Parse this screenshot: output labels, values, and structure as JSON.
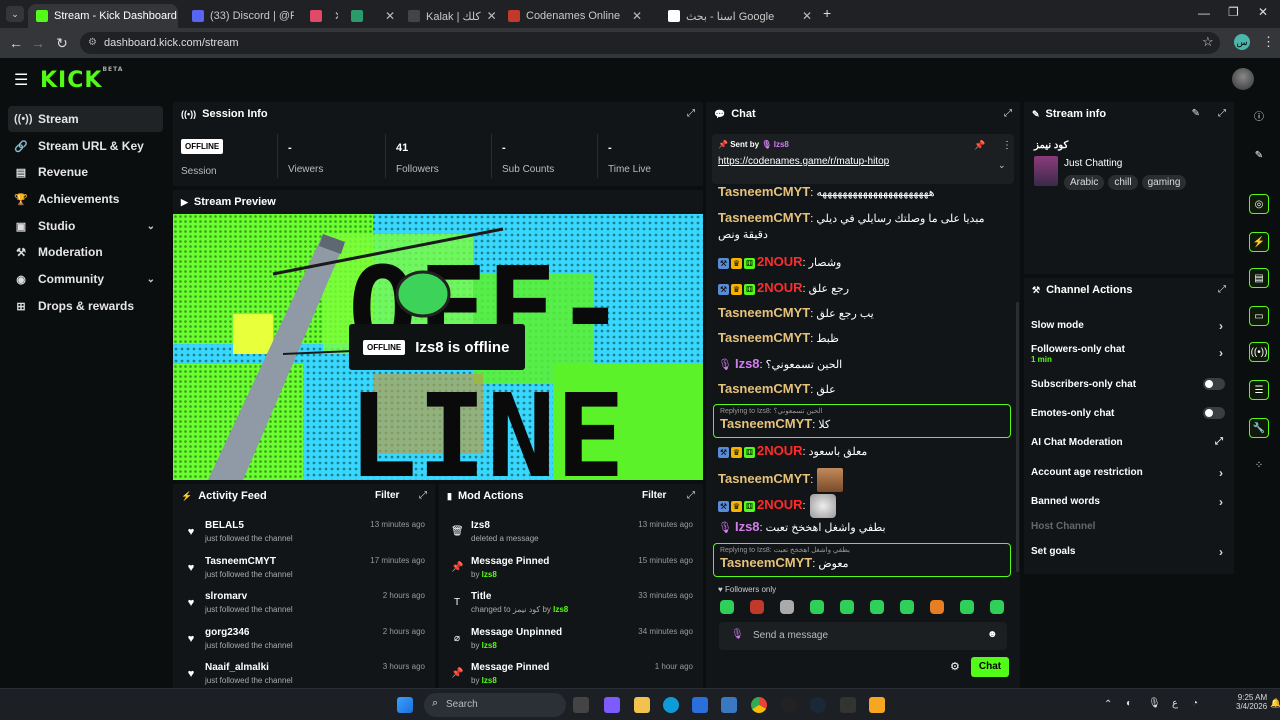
{
  "browser": {
    "tabs": [
      {
        "title": "Stream - Kick Dashboard",
        "color": "#53fc18",
        "active": true
      },
      {
        "title": "(33) Discord | @R.x",
        "color": "#5865f2",
        "active": false
      },
      {
        "title": "",
        "color": "#e04a6a",
        "active": false
      },
      {
        "title": "",
        "color": "#2b9b6b",
        "active": false
      },
      {
        "title": "Kalak | كلك",
        "color": "#444444",
        "active": false
      },
      {
        "title": "Codenames Online",
        "color": "#c0392b",
        "active": false
      },
      {
        "title": "اسنا - بحث Google",
        "color": "#ffffff",
        "active": false
      }
    ],
    "url": "dashboard.kick.com/stream",
    "profile_initial": "س"
  },
  "kick": {
    "logo": "KICK",
    "logo_sup": "BETA"
  },
  "sidebar": {
    "items": [
      {
        "label": "Stream",
        "icon": "stream-icon",
        "glyph": "((•))",
        "chevron": false,
        "active": true
      },
      {
        "label": "Stream URL & Key",
        "icon": "link-icon",
        "glyph": "🔗",
        "chevron": false,
        "active": false
      },
      {
        "label": "Revenue",
        "icon": "chart-icon",
        "glyph": "▤",
        "chevron": false,
        "active": false
      },
      {
        "label": "Achievements",
        "icon": "trophy-icon",
        "glyph": "🏆",
        "chevron": false,
        "active": false
      },
      {
        "label": "Studio",
        "icon": "studio-icon",
        "glyph": "▣",
        "chevron": true,
        "active": false
      },
      {
        "label": "Moderation",
        "icon": "hammer-icon",
        "glyph": "⚒",
        "chevron": false,
        "active": false
      },
      {
        "label": "Community",
        "icon": "globe-icon",
        "glyph": "◉",
        "chevron": true,
        "active": false
      },
      {
        "label": "Drops & rewards",
        "icon": "gift-icon",
        "glyph": "⊞",
        "chevron": false,
        "active": false
      }
    ]
  },
  "session": {
    "title": "Session Info",
    "status_badge": "OFFLINE",
    "status_label": "Session",
    "stats": [
      {
        "value": "-",
        "label": "Viewers"
      },
      {
        "value": "41",
        "label": "Followers"
      },
      {
        "value": "-",
        "label": "Sub Counts"
      },
      {
        "value": "-",
        "label": "Time Live"
      }
    ]
  },
  "preview": {
    "title": "Stream Preview",
    "badge": "OFFLINE",
    "message": "Izs8 is offline",
    "art_line1": "OFF-",
    "art_line2": "LINE"
  },
  "activity": {
    "title": "Activity Feed",
    "filter": "Filter",
    "items": [
      {
        "name": "BELAL5",
        "sub": "just followed the channel",
        "time": "13 minutes ago"
      },
      {
        "name": "TasneemCMYT",
        "sub": "just followed the channel",
        "time": "17 minutes ago"
      },
      {
        "name": "slromarv",
        "sub": "just followed the channel",
        "time": "2 hours ago"
      },
      {
        "name": "gorg2346",
        "sub": "just followed the channel",
        "time": "2 hours ago"
      },
      {
        "name": "Naaif_almalki",
        "sub": "just followed the channel",
        "time": "3 hours ago"
      }
    ]
  },
  "mod_actions": {
    "title": "Mod Actions",
    "filter": "Filter",
    "items": [
      {
        "title": "Izs8",
        "sub_pre": "deleted a message",
        "sub_hi": "",
        "sub_post": "",
        "time": "13 minutes ago",
        "icon": "trash-icon",
        "glyph": "🗑"
      },
      {
        "title": "Message Pinned",
        "sub_pre": "by ",
        "sub_hi": "Izs8",
        "sub_post": "",
        "time": "15 minutes ago",
        "icon": "pin-icon",
        "glyph": "📌"
      },
      {
        "title": "Title",
        "sub_pre": "changed to كود نيمز by ",
        "sub_hi": "Izs8",
        "sub_post": "",
        "time": "33 minutes ago",
        "icon": "title-icon",
        "glyph": "T"
      },
      {
        "title": "Message Unpinned",
        "sub_pre": "by ",
        "sub_hi": "Izs8",
        "sub_post": "",
        "time": "34 minutes ago",
        "icon": "unpin-icon",
        "glyph": "⌀"
      },
      {
        "title": "Message Pinned",
        "sub_pre": "by ",
        "sub_hi": "Izs8",
        "sub_post": "",
        "time": "1 hour ago",
        "icon": "pin-icon",
        "glyph": "📌"
      }
    ]
  },
  "chat": {
    "title": "Chat",
    "pinned": {
      "sent_by_label": "Sent by",
      "sender": "Izs8",
      "link": "https://codenames.game/r/matup-hitop"
    },
    "messages": [
      {
        "user": "TasneemCMYT",
        "text": ": ههههههههههههههههههههههه",
        "style": "gold",
        "badges": false,
        "mic": false
      },
      {
        "user": "TasneemCMYT",
        "text": ": مبديا على ما وصلتك رسايلي في ديلي دقيقة ونص",
        "style": "gold",
        "badges": false,
        "mic": false
      },
      {
        "user": "2NOUR",
        "text": ": وشصار",
        "style": "red",
        "badges": true,
        "mic": false
      },
      {
        "user": "2NOUR",
        "text": ": رجع علق",
        "style": "red",
        "badges": true,
        "mic": false
      },
      {
        "user": "TasneemCMYT",
        "text": ": يب رجع علق",
        "style": "gold",
        "badges": false,
        "mic": false
      },
      {
        "user": "TasneemCMYT",
        "text": ": ظبط",
        "style": "gold",
        "badges": false,
        "mic": false
      },
      {
        "user": "Izs8",
        "text": ": الحين تسمعوني؟",
        "style": "purple",
        "badges": false,
        "mic": true
      },
      {
        "user": "TasneemCMYT",
        "text": ": علق",
        "style": "gold",
        "badges": false,
        "mic": false
      },
      {
        "user": "TasneemCMYT",
        "text": ": كلا",
        "style": "gold",
        "badges": false,
        "mic": false,
        "reply": "Replying to Izs8: الحين تسمعوني؟"
      },
      {
        "user": "2NOUR",
        "text": ": معلق باسعود",
        "style": "red",
        "badges": true,
        "mic": false
      },
      {
        "user": "TasneemCMYT",
        "text": ":",
        "style": "gold",
        "badges": false,
        "mic": false
      },
      {
        "user": "2NOUR",
        "text": ":",
        "style": "red",
        "badges": true,
        "mic": false
      },
      {
        "user": "Izs8",
        "text": ": بطفي واشغل اهخخخ تعبت",
        "style": "purple",
        "badges": false,
        "mic": true
      },
      {
        "user": "TasneemCMYT",
        "text": ": معوض",
        "style": "gold",
        "badges": false,
        "mic": false,
        "reply": "Replying to Izs8: بطفي واشغل اهخخخ تعبت"
      }
    ],
    "followers_only": "Followers only",
    "input_placeholder": "Send a message",
    "send_label": "Chat"
  },
  "stream_info": {
    "title": "Stream info",
    "stream_title": "كود نيمز",
    "category": "Just Chatting",
    "tags": [
      "Arabic",
      "chill",
      "gaming"
    ]
  },
  "channel_actions": {
    "title": "Channel Actions",
    "items": [
      {
        "label": "Slow mode",
        "sub": "",
        "control": "chevron"
      },
      {
        "label": "Followers-only chat",
        "sub": "1 min",
        "control": "chevron"
      },
      {
        "label": "Subscribers-only chat",
        "sub": "",
        "control": "toggle"
      },
      {
        "label": "Emotes-only chat",
        "sub": "",
        "control": "toggle"
      },
      {
        "label": "AI Chat Moderation",
        "sub": "",
        "control": "external"
      },
      {
        "label": "Account age restriction",
        "sub": "",
        "control": "chevron"
      },
      {
        "label": "Banned words",
        "sub": "",
        "control": "chevron"
      },
      {
        "label": "Host Channel",
        "sub": "",
        "control": "disabled"
      },
      {
        "label": "Set goals",
        "sub": "",
        "control": "chevron"
      }
    ]
  },
  "taskbar": {
    "search_placeholder": "Search",
    "time": "9:25 AM",
    "date": "3/4/2026"
  }
}
